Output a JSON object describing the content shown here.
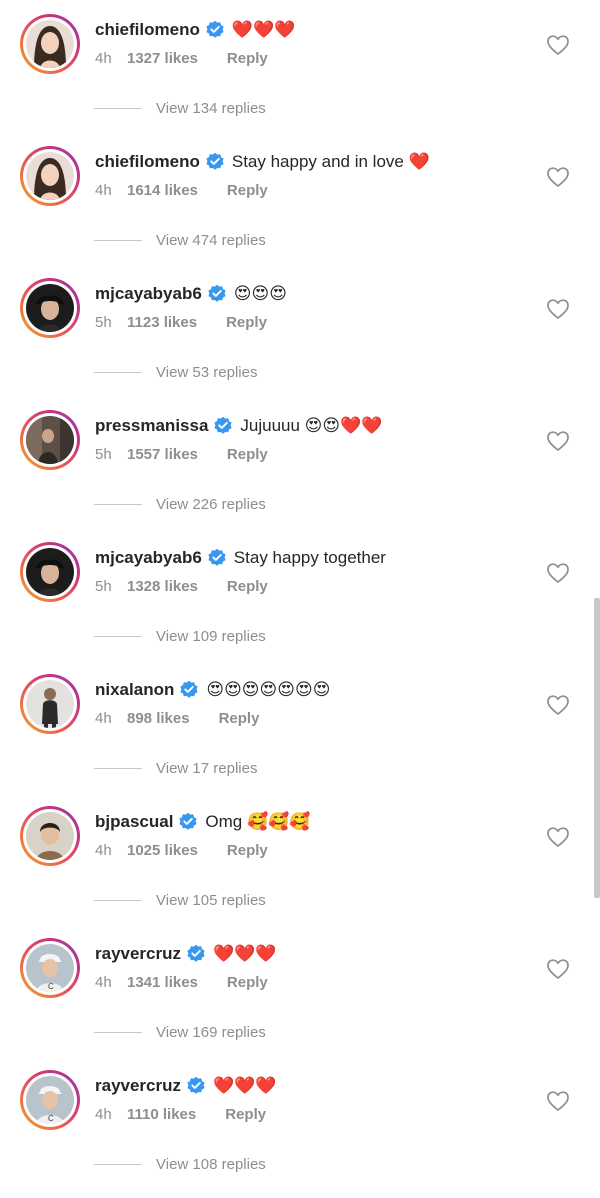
{
  "comments": [
    {
      "username": "chiefilomeno",
      "text": "❤️❤️❤️",
      "time": "4h",
      "likes": "1327 likes",
      "reply_label": "Reply",
      "view_replies": "View 134 replies",
      "avatar": "chiefilomeno-avatar"
    },
    {
      "username": "chiefilomeno",
      "text": "Stay happy and in love ❤️",
      "time": "4h",
      "likes": "1614 likes",
      "reply_label": "Reply",
      "view_replies": "View 474 replies",
      "avatar": "chiefilomeno-avatar"
    },
    {
      "username": "mjcayabyab6",
      "text": "😍😍😍",
      "time": "5h",
      "likes": "1123 likes",
      "reply_label": "Reply",
      "view_replies": "View 53 replies",
      "avatar": "mjcayabyab6-avatar"
    },
    {
      "username": "pressmanissa",
      "text": "Jujuuuu 😍😍❤️❤️",
      "time": "5h",
      "likes": "1557 likes",
      "reply_label": "Reply",
      "view_replies": "View 226 replies",
      "avatar": "pressmanissa-avatar"
    },
    {
      "username": "mjcayabyab6",
      "text": "Stay happy together",
      "time": "5h",
      "likes": "1328 likes",
      "reply_label": "Reply",
      "view_replies": "View 109 replies",
      "avatar": "mjcayabyab6-avatar"
    },
    {
      "username": "nixalanon",
      "text": "😍😍😍😍😍😍😍",
      "time": "4h",
      "likes": "898 likes",
      "reply_label": "Reply",
      "view_replies": "View 17 replies",
      "avatar": "nixalanon-avatar"
    },
    {
      "username": "bjpascual",
      "text": "Omg 🥰🥰🥰",
      "time": "4h",
      "likes": "1025 likes",
      "reply_label": "Reply",
      "view_replies": "View 105 replies",
      "avatar": "bjpascual-avatar"
    },
    {
      "username": "rayvercruz",
      "text": "❤️❤️❤️",
      "time": "4h",
      "likes": "1341 likes",
      "reply_label": "Reply",
      "view_replies": "View 169 replies",
      "avatar": "rayvercruz-avatar"
    },
    {
      "username": "rayvercruz",
      "text": "❤️❤️❤️",
      "time": "4h",
      "likes": "1110 likes",
      "reply_label": "Reply",
      "view_replies": "View 108 replies",
      "avatar": "rayvercruz-avatar"
    }
  ],
  "icons": {
    "verified": "verified-badge-icon",
    "like": "heart-outline-icon"
  },
  "colors": {
    "verified_blue": "#3897f0",
    "secondary_text": "#8e8e8e",
    "primary_text": "#262626"
  }
}
